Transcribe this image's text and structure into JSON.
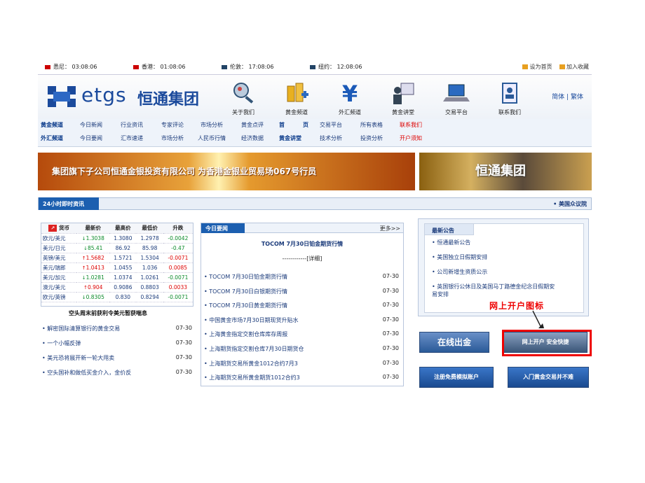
{
  "clocks": [
    {
      "label": "悉尼：",
      "time": "03:08:06"
    },
    {
      "label": "香港：",
      "time": "01:08:06"
    },
    {
      "label": "伦敦：",
      "time": "17:08:06"
    },
    {
      "label": "纽约：",
      "time": "12:08:06"
    }
  ],
  "top_links": [
    "设为首页",
    "加入收藏"
  ],
  "logo": {
    "en": "etgs",
    "cn": "恒通集团"
  },
  "nav_icons": [
    "关于我们",
    "黄金频道",
    "外汇频道",
    "黄金讲堂",
    "交易平台",
    "联系我们"
  ],
  "lang": {
    "simplified": "简体",
    "sep": "|",
    "traditional": "繁体"
  },
  "menu_gold": [
    "黄金频道",
    "今日新闻",
    "行业资讯",
    "专家评论",
    "市场分析",
    "黄金点评",
    "首",
    "页",
    "交易平台",
    "所有表格",
    "联系我们"
  ],
  "menu_fx": [
    "外汇频道",
    "今日要闻",
    "汇市速递",
    "市场分析",
    "人民币行情",
    "经济数据",
    "黄金讲堂",
    "技术分析",
    "投资分析",
    "开户须知"
  ],
  "banner_left": "集团旗下子公司恒通金银投资有限公司  为香港金银业贸易场067号行员",
  "banner_right": "恒通集团",
  "news_tab": "24小时即时资讯",
  "news_right": "美国众议院",
  "rates_header": [
    "货币",
    "最新价",
    "最高价",
    "最低价",
    "升跌"
  ],
  "rates": [
    {
      "pair": "欧元/美元",
      "dir": "dn",
      "last": "1.3038",
      "high": "1.3080",
      "low": "1.2978",
      "chg": "-0.0042"
    },
    {
      "pair": "美元/日元",
      "dir": "dn",
      "last": "85.41",
      "high": "86.92",
      "low": "85.98",
      "chg": "-0.47"
    },
    {
      "pair": "英镑/美元",
      "dir": "up",
      "last": "1.5682",
      "high": "1.5721",
      "low": "1.5304",
      "chg": "-0.0071"
    },
    {
      "pair": "美元/瑞郎",
      "dir": "up",
      "last": "1.0413",
      "high": "1.0455",
      "low": "1.036",
      "chg": "0.0085"
    },
    {
      "pair": "美元/加元",
      "dir": "dn",
      "last": "1.0281",
      "high": "1.0374",
      "low": "1.0261",
      "chg": "-0.0071"
    },
    {
      "pair": "澳元/美元",
      "dir": "up",
      "last": "0.904",
      "high": "0.9086",
      "low": "0.8803",
      "chg": "0.0033"
    },
    {
      "pair": "欧元/英镑",
      "dir": "dn",
      "last": "0.8305",
      "high": "0.830",
      "low": "0.8294",
      "chg": "-0.0071"
    }
  ],
  "weekly_title": "空头周末前获利令美元暂获喘息",
  "left_news": [
    {
      "title": "解密国际清算银行的黄金交易",
      "date": "07-30"
    },
    {
      "title": "一个小幅反弹",
      "date": "07-30"
    },
    {
      "title": "美元恐将展开新一轮大甩卖",
      "date": "07-30"
    },
    {
      "title": "空头国补和做低买金介入，金价反",
      "date": "07-30"
    }
  ],
  "today": {
    "tab": "今日要闻",
    "more": "更多>>",
    "feature": "TOCOM 7月30日铂金期货行情",
    "detail": "------------[详细]",
    "list": [
      {
        "title": "TOCOM 7月30日铂金期货行情",
        "date": "07-30"
      },
      {
        "title": "TOCOM 7月30日白银期货行情",
        "date": "07-30"
      },
      {
        "title": "TOCOM 7月30日黄金期货行情",
        "date": "07-30"
      },
      {
        "title": "中国黄金市场7月30日期现货升贴水",
        "date": "07-30"
      },
      {
        "title": "上海黄金指定交割仓库库存周报",
        "date": "07-30"
      },
      {
        "title": "上海期货指定交割仓库7月30日期货仓",
        "date": "07-30"
      },
      {
        "title": "上海期货交易所黄金1012合约7月3",
        "date": "07-30"
      },
      {
        "title": "上海期货交易所黄金期货1012合约3",
        "date": "07-30"
      }
    ]
  },
  "notice": {
    "tab": "最新公告",
    "items": [
      "恒通最新公告",
      "美国独立日假期安排",
      "公司新增生资质公示",
      "英国银行公休日及美国马丁路德金纪念日假期安",
      "易安排"
    ]
  },
  "annotation": "网上开户图标",
  "buttons": {
    "online": "在线出金",
    "open_account": "网上开户  安全快捷",
    "register": "注册免费模拟账户",
    "customer": "入门黄金交易并不难"
  }
}
